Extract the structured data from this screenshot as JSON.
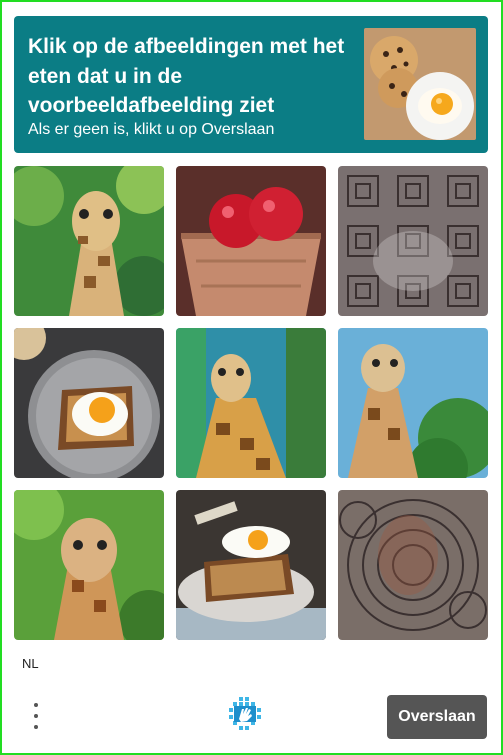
{
  "header": {
    "title": "Klik op de afbeeldingen met het eten dat u in de voorbeeldafbeelding ziet",
    "subtitle": "Als er geen is, klikt u op Overslaan",
    "background_color": "#0b7d85",
    "sample_image": "cookies-and-fried-egg-image"
  },
  "grid": {
    "tiles": [
      {
        "name": "giraffe-image"
      },
      {
        "name": "apples-basket-image"
      },
      {
        "name": "noise-pattern-image"
      },
      {
        "name": "fried-egg-toast-image"
      },
      {
        "name": "giraffe-image"
      },
      {
        "name": "giraffe-image"
      },
      {
        "name": "giraffe-image"
      },
      {
        "name": "eggs-on-toast-image"
      },
      {
        "name": "noise-pattern-image"
      }
    ]
  },
  "footer": {
    "language": "NL",
    "skip_label": "Overslaan",
    "menu_icon": "more-vertical-icon",
    "logo_icon": "hcaptcha-logo-icon"
  },
  "colors": {
    "border": "#22dd22",
    "button": "#555555"
  }
}
